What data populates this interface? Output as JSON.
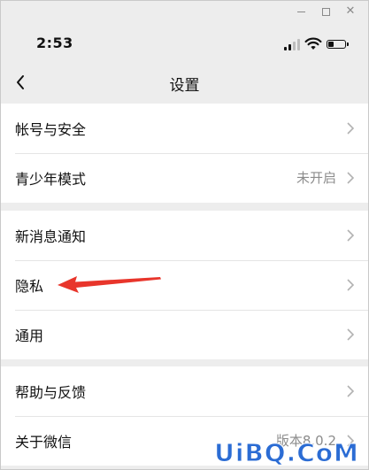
{
  "status_bar": {
    "time": "2:53",
    "battery_level": 0.35,
    "signal_bars": 2
  },
  "nav": {
    "title": "设置"
  },
  "groups": [
    {
      "items": [
        {
          "label": "帐号与安全",
          "value": ""
        },
        {
          "label": "青少年模式",
          "value": "未开启"
        }
      ]
    },
    {
      "items": [
        {
          "label": "新消息通知",
          "value": ""
        },
        {
          "label": "隐私",
          "value": ""
        },
        {
          "label": "通用",
          "value": ""
        }
      ]
    },
    {
      "items": [
        {
          "label": "帮助与反馈",
          "value": ""
        },
        {
          "label": "关于微信",
          "value": "版本8.0.2"
        }
      ]
    }
  ],
  "watermark": {
    "text": "UiBQ.CoM"
  },
  "colors": {
    "annotation_arrow": "#e8352b",
    "watermark_blue": "#2b6cd4"
  }
}
